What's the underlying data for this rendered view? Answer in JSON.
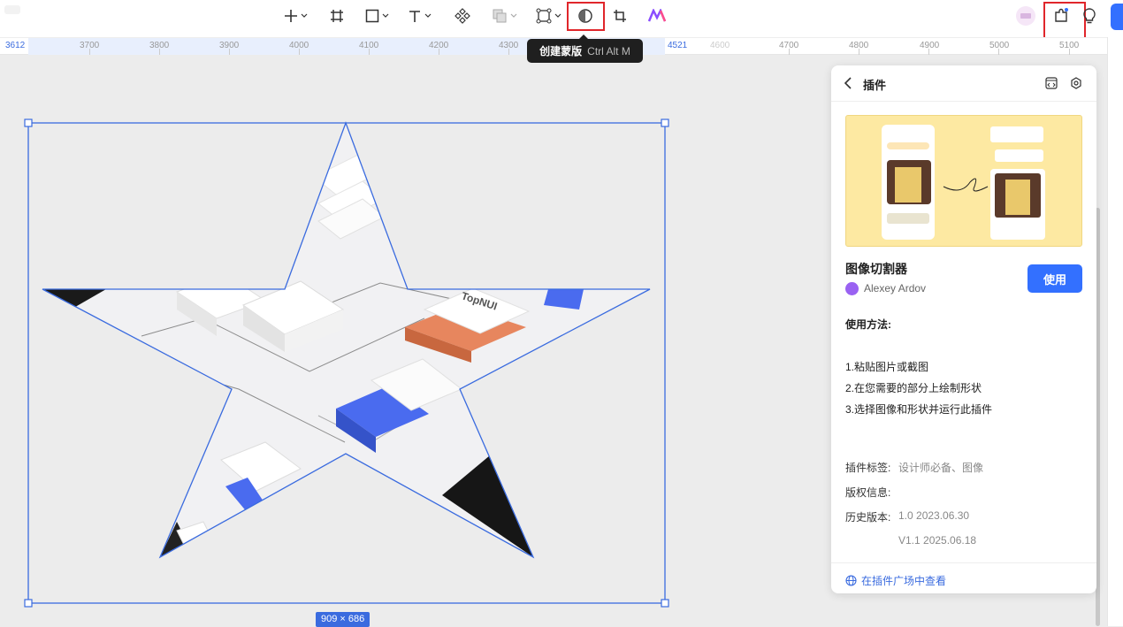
{
  "toolbar": {
    "tooltip_label": "创建蒙版",
    "tooltip_shortcut": "Ctrl Alt M"
  },
  "ruler": {
    "ticks_left": [
      "3612",
      "3700",
      "3800",
      "3900",
      "4000",
      "4100",
      "4200",
      "4300"
    ],
    "tick_right_start": "4521",
    "tick_faint": "4600",
    "ticks_right": [
      "4700",
      "4800",
      "4900",
      "5000",
      "5100"
    ]
  },
  "canvas": {
    "selection_size": "909 × 686",
    "image_labels": [
      "TopNUI"
    ]
  },
  "plugin_panel": {
    "title": "插件",
    "plugin_name": "图像切割器",
    "author": "Alexey Ardov",
    "use_button": "使用",
    "usage_heading": "使用方法:",
    "steps": [
      "1.粘贴图片或截图",
      "2.在您需要的部分上绘制形状",
      "3.选择图像和形状并运行此插件"
    ],
    "tags_label": "插件标签:",
    "tags_value": "设计师必备、图像",
    "copyright_label": "版权信息:",
    "history_label": "历史版本:",
    "history_values": [
      "1.0 2023.06.30",
      "V1.1 2025.06.18"
    ],
    "market_link": "在插件广场中查看"
  },
  "colors": {
    "accent": "#3370ff",
    "highlight_box": "#e0262b",
    "selection": "#3a6bdf",
    "banner_bg": "#fde9a2"
  }
}
